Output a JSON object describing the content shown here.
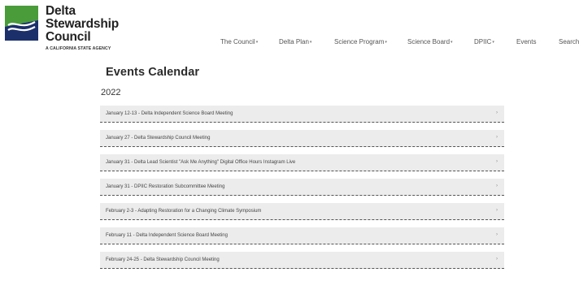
{
  "header": {
    "logo_lines": [
      "Delta",
      "Stewardship",
      "Council"
    ],
    "tagline": "A CALIFORNIA STATE AGENCY",
    "brand_colors": {
      "blue": "#1f4e9c",
      "green": "#4a9b3a",
      "navy": "#1b2f6b"
    }
  },
  "nav": {
    "items": [
      {
        "label": "The Council",
        "has_dropdown": true
      },
      {
        "label": "Delta Plan",
        "has_dropdown": true
      },
      {
        "label": "Science Program",
        "has_dropdown": true
      },
      {
        "label": "Science Board",
        "has_dropdown": true
      },
      {
        "label": "DPIIC",
        "has_dropdown": true
      },
      {
        "label": "Events",
        "has_dropdown": false
      },
      {
        "label": "Search",
        "has_dropdown": false
      }
    ]
  },
  "main": {
    "title": "Events Calendar",
    "year": "2022",
    "events": [
      "January 12-13 - Delta Independent Science Board Meeting",
      "January 27 - Delta Stewardship Council Meeting",
      "January 31 - Delta Lead Scientist \"Ask Me Anything\" Digital Office Hours Instagram Live",
      "January 31 - DPIIC Restoration Subcommittee Meeting",
      "February 2-3 - Adapting Restoration for a Changing Climate Symposium",
      "February 11 - Delta Independent Science Board Meeting",
      "February 24-25 - Delta Stewardship Council Meeting"
    ],
    "row_arrow": "›"
  }
}
